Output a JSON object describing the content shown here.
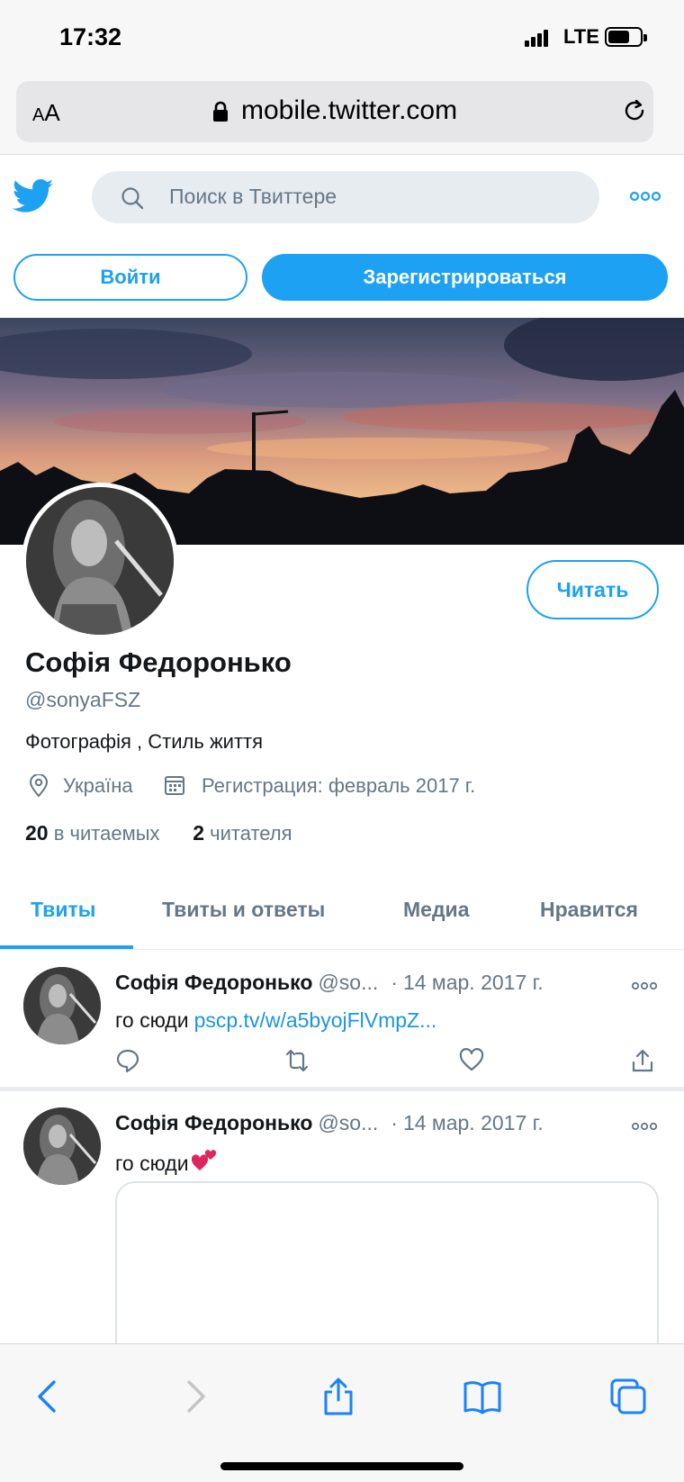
{
  "status_bar": {
    "time": "17:32",
    "network": "LTE"
  },
  "browser": {
    "text_size_label": "A",
    "text_size_label_big": "A",
    "url": "mobile.twitter.com"
  },
  "header": {
    "search_placeholder": "Поиск в Твиттере"
  },
  "auth": {
    "login_label": "Войти",
    "signup_label": "Зарегистрироваться"
  },
  "profile": {
    "follow_label": "Читать",
    "name": "Софія Федоронько",
    "handle": "@sonyaFSZ",
    "bio": "Фотографія , Стиль життя",
    "location": "Україна",
    "joined": "Регистрация: февраль 2017 г.",
    "following_count": "20",
    "following_label": "в читаемых",
    "followers_count": "2",
    "followers_label": "читателя"
  },
  "tabs": [
    {
      "label": "Твиты",
      "active": true
    },
    {
      "label": "Твиты и ответы",
      "active": false
    },
    {
      "label": "Медиа",
      "active": false
    },
    {
      "label": "Нравится",
      "active": false
    }
  ],
  "tweets": [
    {
      "author": "Софія Федоронько",
      "handle": "@so...",
      "separator": "·",
      "date": "14 мар. 2017 г.",
      "text": "го сюди",
      "link": "pscp.tv/w/a5byojFlVmpZ..."
    },
    {
      "author": "Софія Федоронько",
      "handle": "@so...",
      "separator": "·",
      "date": "14 мар. 2017 г.",
      "text": "го сюди"
    }
  ],
  "colors": {
    "accent": "#1da1f2",
    "link": "#1b95e0",
    "secondary_text": "#657786",
    "heart_emoji": "#e0245e"
  }
}
